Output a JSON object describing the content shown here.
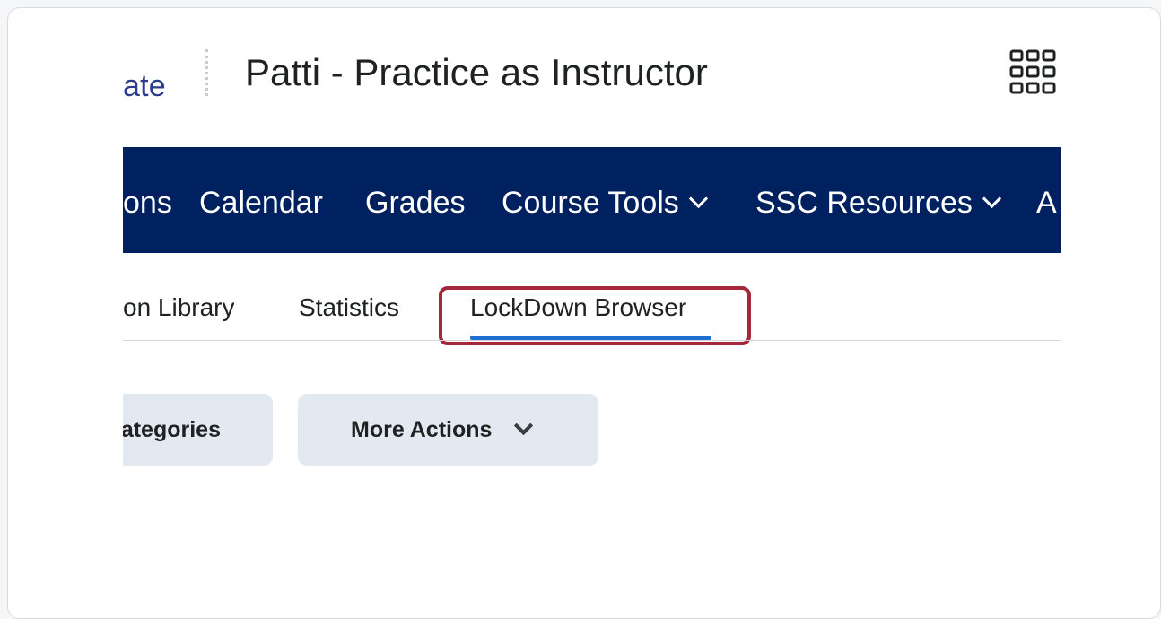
{
  "header": {
    "logo_fragment": "ate",
    "course_title": "Patti - Practice as Instructor",
    "waffle_icon": "grid-icon"
  },
  "navbar": {
    "background": "#002160",
    "items": [
      {
        "label": "ons"
      },
      {
        "label": "Calendar"
      },
      {
        "label": "Grades"
      },
      {
        "label": "Course Tools",
        "dropdown": true
      },
      {
        "label": "SSC Resources",
        "dropdown": true
      },
      {
        "label": "A"
      }
    ]
  },
  "tabs": [
    {
      "label": "on Library"
    },
    {
      "label": "Statistics"
    },
    {
      "label": "LockDown Browser",
      "active": true
    }
  ],
  "actions": {
    "categories_label": "ategories",
    "more_actions_label": "More Actions"
  },
  "colors": {
    "accent_underline": "#1f6fd1",
    "highlight_border": "#a4273a",
    "button_bg": "#e3e9f1"
  }
}
